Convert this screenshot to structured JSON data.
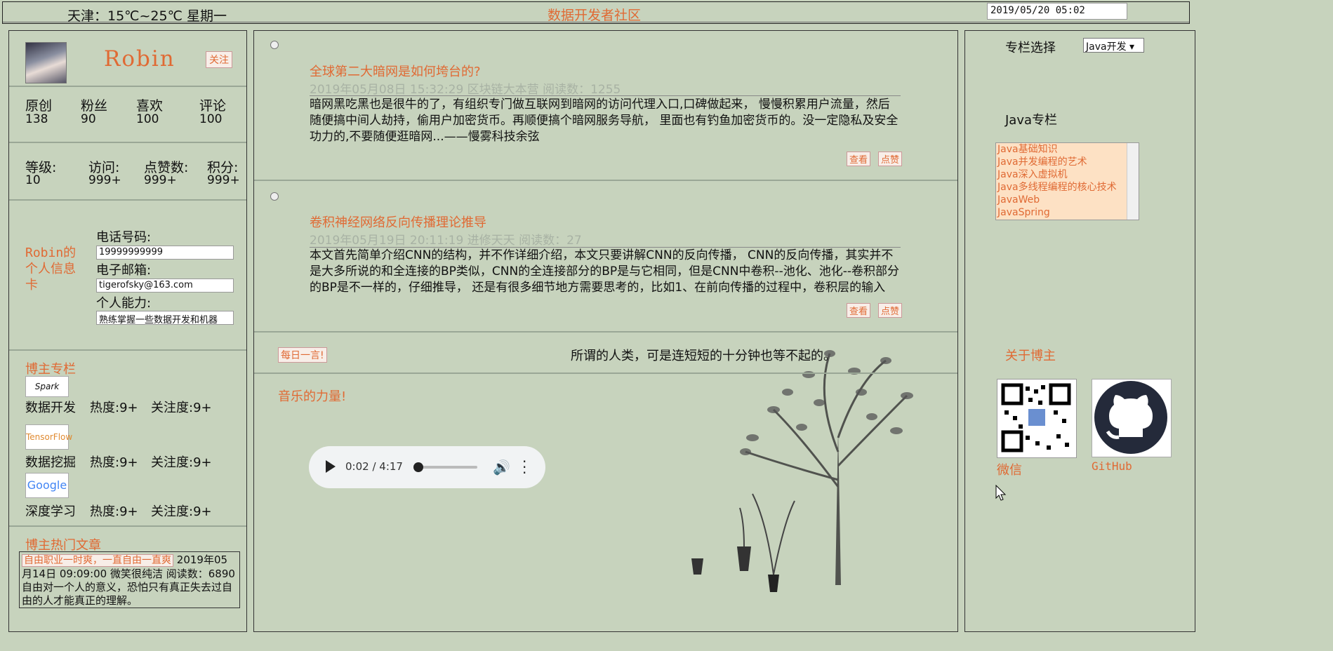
{
  "topbar": {
    "weather": "天津：15℃~25℃ 星期一",
    "site_title": "数据开发者社区",
    "datetime": "2019/05/20 05:02"
  },
  "profile": {
    "username": "Robin",
    "follow_label": "关注",
    "stats1": [
      {
        "label": "原创",
        "value": "138"
      },
      {
        "label": "粉丝",
        "value": "90"
      },
      {
        "label": "喜欢",
        "value": "100"
      },
      {
        "label": "评论",
        "value": "100"
      }
    ],
    "stats2": [
      {
        "label": "等级:",
        "value": "10"
      },
      {
        "label": "访问:",
        "value": "999+"
      },
      {
        "label": "点赞数:",
        "value": "999+"
      },
      {
        "label": "积分:",
        "value": "999+"
      }
    ],
    "card_title": "Robin的个人信息卡",
    "phone_label": "电话号码:",
    "phone_value": "19999999999",
    "email_label": "电子邮箱:",
    "email_value": "tigerofsky@163.com",
    "ability_label": "个人能力:",
    "ability_value": "熟练掌握一些数据开发和机器"
  },
  "columns": {
    "title": "博主专栏",
    "items": [
      {
        "logo": "Spark",
        "name": "数据开发",
        "heat": "热度:9+",
        "focus": "关注度:9+"
      },
      {
        "logo": "TensorFlow",
        "name": "数据挖掘",
        "heat": "热度:9+",
        "focus": "关注度:9+"
      },
      {
        "logo": "Google",
        "name": "深度学习",
        "heat": "热度:9+",
        "focus": "关注度:9+"
      }
    ]
  },
  "hot": {
    "title": "博主热门文章",
    "tag": "自由职业一时爽，一直自由一直爽",
    "text": "2019年05月14日 09:09:00 微笑很纯洁 阅读数：6890 自由对一个人的意义，恐怕只有真正失去过自由的人才能真正的理解。"
  },
  "articles": [
    {
      "title": "全球第二大暗网是如何垮台的?",
      "meta": "2019年05月08日 15:32:29 区块链大本营 阅读数：1255",
      "body": "暗网黑吃黑也是很牛的了，有组织专门做互联网到暗网的访问代理入口,口碑做起来， 慢慢积累用户流量，然后随便搞中间人劫持，偷用户加密货币。再顺便搞个暗网服务导航， 里面也有钓鱼加密货币的。没一定隐私及安全功力的,不要随便逛暗网...——慢雾科技余弦",
      "view_label": "查看",
      "like_label": "点赞"
    },
    {
      "title": "卷积神经网络反向传播理论推导",
      "meta": "2019年05月19日 20:11:19 进修天天 阅读数：27",
      "body": "本文首先简单介绍CNN的结构，并不作详细介绍，本文只要讲解CNN的反向传播， CNN的反向传播，其实并不是大多所说的和全连接的BP类似，CNN的全连接部分的BP是与它相同，但是CNN中卷积--池化、池化--卷积部分的BP是不一样的，仔细推导， 还是有很多细节地方需要思考的，比如1、在前向传播的过程中，卷积层的输入",
      "view_label": "查看",
      "like_label": "点赞"
    }
  ],
  "daily": {
    "button": "每日一言!",
    "quote": "所谓的人类，可是连短短的十分钟也等不起的。"
  },
  "music": {
    "title": "音乐的力量!",
    "time": "0:02 / 4:17",
    "progress": 0.008
  },
  "right": {
    "select_label": "专栏选择",
    "select_value": "Java开发 ▾",
    "java_title": "Java专栏",
    "java_items": [
      "Java基础知识",
      "Java并发编程的艺术",
      "Java深入虚拟机",
      "Java多线程编程的核心技术",
      "JavaWeb",
      "JavaSpring"
    ],
    "about_title": "关于博主",
    "wechat_label": "微信",
    "github_label": "GitHub"
  }
}
